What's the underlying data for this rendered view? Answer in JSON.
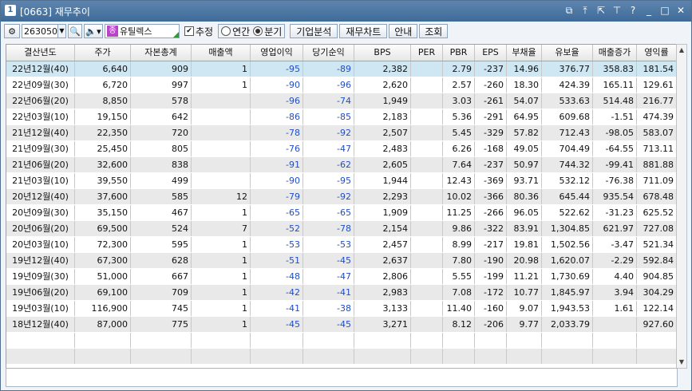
{
  "title": {
    "num": "1",
    "text": "[0663] 재무추이"
  },
  "toolbar": {
    "code": "263050",
    "company": "유틸렉스",
    "badge": "종",
    "estimate_label": "추정",
    "annual_label": "연간",
    "quarter_label": "분기",
    "btn_analysis": "기업분석",
    "btn_chart": "재무차트",
    "btn_guide": "안내",
    "btn_query": "조회"
  },
  "columns": [
    "결산년도",
    "주가",
    "자본총계",
    "매출액",
    "영업이익",
    "당기순익",
    "BPS",
    "PER",
    "PBR",
    "EPS",
    "부채율",
    "유보율",
    "매출증가",
    "영익률"
  ],
  "rows": [
    [
      "22년12월(40)",
      "6,640",
      "909",
      "1",
      "-95",
      "-89",
      "2,382",
      "",
      "2.79",
      "-237",
      "14.96",
      "376.77",
      "358.83",
      "181.54"
    ],
    [
      "22년09월(30)",
      "6,720",
      "997",
      "1",
      "-90",
      "-96",
      "2,620",
      "",
      "2.57",
      "-260",
      "18.30",
      "424.39",
      "165.11",
      "129.61"
    ],
    [
      "22년06월(20)",
      "8,850",
      "578",
      "",
      "-96",
      "-74",
      "1,949",
      "",
      "3.03",
      "-261",
      "54.07",
      "533.63",
      "514.48",
      "216.77"
    ],
    [
      "22년03월(10)",
      "19,150",
      "642",
      "",
      "-86",
      "-85",
      "2,183",
      "",
      "5.36",
      "-291",
      "64.95",
      "609.68",
      "-1.51",
      "474.39"
    ],
    [
      "21년12월(40)",
      "22,350",
      "720",
      "",
      "-78",
      "-92",
      "2,507",
      "",
      "5.45",
      "-329",
      "57.82",
      "712.43",
      "-98.05",
      "583.07"
    ],
    [
      "21년09월(30)",
      "25,450",
      "805",
      "",
      "-76",
      "-47",
      "2,483",
      "",
      "6.26",
      "-168",
      "49.05",
      "704.49",
      "-64.55",
      "713.11"
    ],
    [
      "21년06월(20)",
      "32,600",
      "838",
      "",
      "-91",
      "-62",
      "2,605",
      "",
      "7.64",
      "-237",
      "50.97",
      "744.32",
      "-99.41",
      "881.88"
    ],
    [
      "21년03월(10)",
      "39,550",
      "499",
      "",
      "-90",
      "-95",
      "1,944",
      "",
      "12.43",
      "-369",
      "93.71",
      "532.12",
      "-76.38",
      "711.09"
    ],
    [
      "20년12월(40)",
      "37,600",
      "585",
      "12",
      "-79",
      "-92",
      "2,293",
      "",
      "10.02",
      "-366",
      "80.36",
      "645.44",
      "935.54",
      "678.48"
    ],
    [
      "20년09월(30)",
      "35,150",
      "467",
      "1",
      "-65",
      "-65",
      "1,909",
      "",
      "11.25",
      "-266",
      "96.05",
      "522.62",
      "-31.23",
      "625.52"
    ],
    [
      "20년06월(20)",
      "69,500",
      "524",
      "7",
      "-52",
      "-78",
      "2,154",
      "",
      "9.86",
      "-322",
      "83.91",
      "1,304.85",
      "621.97",
      "727.08"
    ],
    [
      "20년03월(10)",
      "72,300",
      "595",
      "1",
      "-53",
      "-53",
      "2,457",
      "",
      "8.99",
      "-217",
      "19.81",
      "1,502.56",
      "-3.47",
      "521.34"
    ],
    [
      "19년12월(40)",
      "67,300",
      "628",
      "1",
      "-51",
      "-45",
      "2,637",
      "",
      "7.80",
      "-190",
      "20.98",
      "1,620.07",
      "-2.29",
      "592.84"
    ],
    [
      "19년09월(30)",
      "51,000",
      "667",
      "1",
      "-48",
      "-47",
      "2,806",
      "",
      "5.55",
      "-199",
      "11.21",
      "1,730.69",
      "4.40",
      "904.85"
    ],
    [
      "19년06월(20)",
      "69,100",
      "709",
      "1",
      "-42",
      "-41",
      "2,983",
      "",
      "7.08",
      "-172",
      "10.77",
      "1,845.97",
      "3.94",
      "304.29"
    ],
    [
      "19년03월(10)",
      "116,900",
      "745",
      "1",
      "-41",
      "-38",
      "3,133",
      "",
      "11.40",
      "-160",
      "9.07",
      "1,943.53",
      "1.61",
      "122.14"
    ],
    [
      "18년12월(40)",
      "87,000",
      "775",
      "1",
      "-45",
      "-45",
      "3,271",
      "",
      "8.12",
      "-206",
      "9.77",
      "2,033.79",
      "",
      "927.60"
    ]
  ],
  "colors": {
    "title_bar": "#4a76a3",
    "selected_row": "#cfe6f3",
    "alt_row": "#e9e9e9",
    "negative": "#1f4ec8"
  },
  "icons": [
    "settings-icon",
    "search-icon",
    "speaker-icon",
    "restore-window-icon",
    "pin-icon",
    "popout-icon",
    "help-icon",
    "minimize-icon",
    "maximize-icon",
    "close-icon"
  ]
}
